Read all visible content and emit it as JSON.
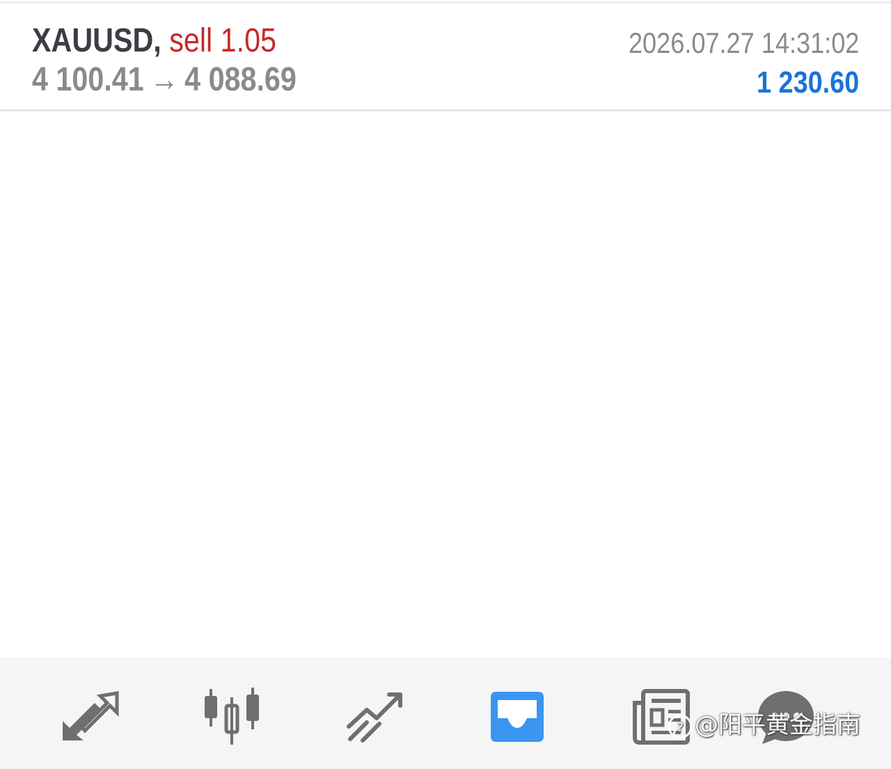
{
  "trade": {
    "symbol": "XAUUSD",
    "separator": ",",
    "side_volume": "sell 1.05",
    "open_price": "4 100.41",
    "arrow": "→",
    "current_price": "4 088.69",
    "time": "2026.07.27 14:31:02",
    "profit": "1 230.60"
  },
  "colors": {
    "symbol": "#3b3d45",
    "sell": "#c9282a",
    "price": "#8a8a8e",
    "profit": "#1a73d9",
    "active_tab": "#3a96f0",
    "inactive_tab": "#6f6f6f"
  },
  "bottom_nav": {
    "items": [
      {
        "icon": "quotes-arrows-icon"
      },
      {
        "icon": "candlestick-chart-icon"
      },
      {
        "icon": "trend-line-icon"
      },
      {
        "icon": "trade-tray-icon",
        "active": true
      },
      {
        "icon": "news-icon"
      },
      {
        "icon": "chat-bubble-icon"
      }
    ]
  },
  "watermark": {
    "text": "@阳平黄金指南"
  }
}
